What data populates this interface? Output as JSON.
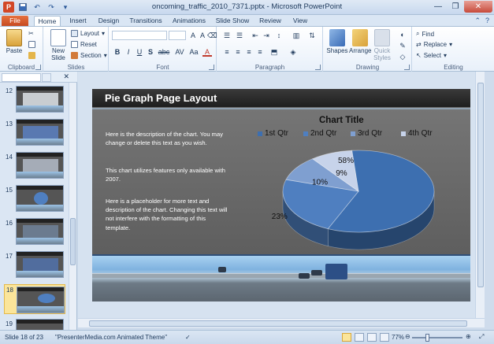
{
  "window": {
    "title": "oncoming_traffic_2010_7371.pptx - Microsoft PowerPoint",
    "app_letter": "P"
  },
  "tabs": [
    {
      "label": "File"
    },
    {
      "label": "Home"
    },
    {
      "label": "Insert"
    },
    {
      "label": "Design"
    },
    {
      "label": "Transitions"
    },
    {
      "label": "Animations"
    },
    {
      "label": "Slide Show"
    },
    {
      "label": "Review"
    },
    {
      "label": "View"
    }
  ],
  "ribbon": {
    "clipboard": {
      "label": "Clipboard",
      "paste": "Paste"
    },
    "slides": {
      "label": "Slides",
      "new_slide": "New Slide",
      "layout": "Layout",
      "reset": "Reset",
      "section": "Section"
    },
    "font": {
      "label": "Font",
      "bold": "B",
      "italic": "I",
      "underline": "U",
      "strike": "S",
      "shadow": "abc",
      "spacing": "AV",
      "case": "Aa",
      "color": "A"
    },
    "paragraph": {
      "label": "Paragraph"
    },
    "drawing": {
      "label": "Drawing",
      "shapes": "Shapes",
      "arrange": "Arrange",
      "quick_styles": "Quick Styles"
    },
    "editing": {
      "label": "Editing",
      "find": "Find",
      "replace": "Replace",
      "select": "Select"
    }
  },
  "thumbnails": [
    {
      "num": "12"
    },
    {
      "num": "13"
    },
    {
      "num": "14"
    },
    {
      "num": "15"
    },
    {
      "num": "16"
    },
    {
      "num": "17"
    },
    {
      "num": "18"
    },
    {
      "num": "19"
    }
  ],
  "slide": {
    "title": "Pie Graph Page Layout",
    "paragraphs": [
      "Here is the description  of the chart. You may change or delete this text as you wish.",
      "This chart utilizes features only available with  2007.",
      "Here is a placeholder  for more text and description  of the chart. Changing  this text will not interfere with the formatting of this template."
    ]
  },
  "chart_data": {
    "type": "pie",
    "title": "Chart Title",
    "categories": [
      "1st Qtr",
      "2nd Qtr",
      "3rd Qtr",
      "4th Qtr"
    ],
    "values": [
      58,
      23,
      10,
      9
    ],
    "value_labels": [
      "58%",
      "23%",
      "10%",
      "9%"
    ],
    "colors": [
      "#3d6fb0",
      "#4f7fc0",
      "#7f9fd0",
      "#c7d3ea"
    ],
    "legend_position": "top",
    "style": "3d"
  },
  "status": {
    "slide": "Slide 18 of 23",
    "theme": "\"PresenterMedia.com Animated Theme\"",
    "zoom": "77%"
  }
}
